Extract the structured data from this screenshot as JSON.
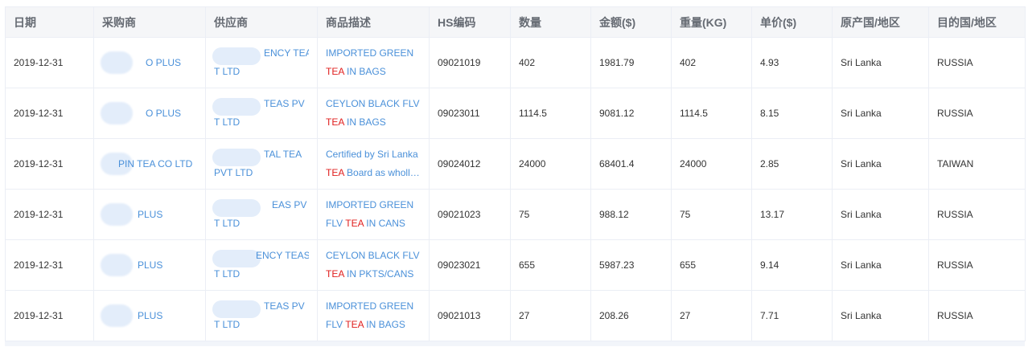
{
  "headers": [
    "日期",
    "采购商",
    "供应商",
    "商品描述",
    "HS编码",
    "数量",
    "金额($)",
    "重量(KG)",
    "单价($)",
    "原产国/地区",
    "目的国/地区"
  ],
  "highlight_word": "TEA",
  "rows": [
    {
      "date": "2019-12-31",
      "buyer": "O PLUS",
      "supplier1": "ENCY TEAS PV",
      "supplier2": "T LTD",
      "desc1": "IMPORTED GREEN",
      "desc2_pre": "",
      "desc2_hl": "TEA",
      "desc2_post": " IN BAGS",
      "hs": "09021019",
      "qty": "402",
      "amount": "1981.79",
      "weight": "402",
      "unit": "4.93",
      "origin": "Sri Lanka",
      "dest": "RUSSIA"
    },
    {
      "date": "2019-12-31",
      "buyer": "O PLUS",
      "supplier1": "TEAS PV",
      "supplier2": "T LTD",
      "desc1": "CEYLON BLACK FLV",
      "desc2_pre": "",
      "desc2_hl": "TEA",
      "desc2_post": " IN BAGS",
      "hs": "09023011",
      "qty": "1114.5",
      "amount": "9081.12",
      "weight": "1114.5",
      "unit": "8.15",
      "origin": "Sri Lanka",
      "dest": "RUSSIA"
    },
    {
      "date": "2019-12-31",
      "buyer": "PIN TEA CO LTD",
      "supplier1": "TAL TEA",
      "supplier2": "PVT LTD",
      "desc1": "Certified by Sri Lanka",
      "desc2_pre": "",
      "desc2_hl": "TEA",
      "desc2_post": " Board as wholl…",
      "hs": "09024012",
      "qty": "24000",
      "amount": "68401.4",
      "weight": "24000",
      "unit": "2.85",
      "origin": "Sri Lanka",
      "dest": "TAIWAN"
    },
    {
      "date": "2019-12-31",
      "buyer": "PLUS",
      "supplier1": "EAS PV",
      "supplier2": "T LTD",
      "desc1": "IMPORTED GREEN",
      "desc2_pre": "FLV ",
      "desc2_hl": "TEA",
      "desc2_post": " IN CANS",
      "hs": "09021023",
      "qty": "75",
      "amount": "988.12",
      "weight": "75",
      "unit": "13.17",
      "origin": "Sri Lanka",
      "dest": "RUSSIA"
    },
    {
      "date": "2019-12-31",
      "buyer": "PLUS",
      "supplier1": "ENCY TEAS PV",
      "supplier2": "T LTD",
      "desc1": "CEYLON BLACK FLV",
      "desc2_pre": "",
      "desc2_hl": "TEA",
      "desc2_post": " IN PKTS/CANS",
      "hs": "09023021",
      "qty": "655",
      "amount": "5987.23",
      "weight": "655",
      "unit": "9.14",
      "origin": "Sri Lanka",
      "dest": "RUSSIA"
    },
    {
      "date": "2019-12-31",
      "buyer": "PLUS",
      "supplier1": "TEAS PV",
      "supplier2": "T LTD",
      "desc1": "IMPORTED GREEN",
      "desc2_pre": "FLV ",
      "desc2_hl": "TEA",
      "desc2_post": " IN BAGS",
      "hs": "09021013",
      "qty": "27",
      "amount": "208.26",
      "weight": "27",
      "unit": "7.71",
      "origin": "Sri Lanka",
      "dest": "RUSSIA"
    }
  ]
}
